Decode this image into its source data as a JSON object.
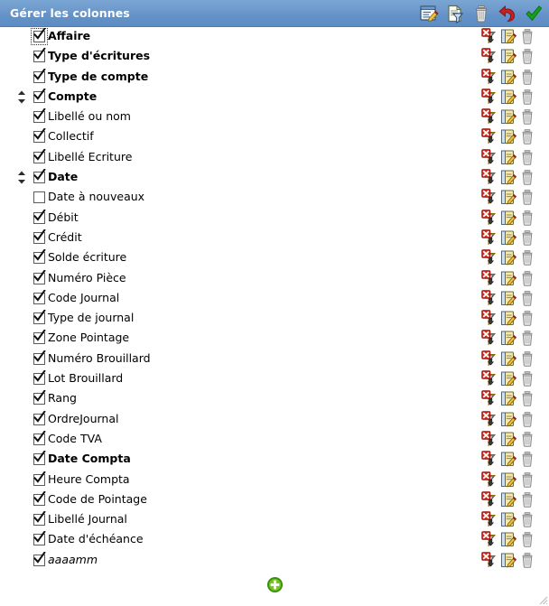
{
  "window": {
    "title": "Gérer les colonnes",
    "titlebar_color": "#6898cc",
    "title_text_color": "#ffffff"
  },
  "toolbar": {
    "icons": [
      {
        "name": "edit-note-icon",
        "label": "Éditer"
      },
      {
        "name": "document-filter-icon",
        "label": "Filtrer"
      },
      {
        "name": "trash-icon",
        "label": "Supprimer"
      },
      {
        "name": "undo-icon",
        "label": "Annuler"
      },
      {
        "name": "validate-check-icon",
        "label": "Valider"
      }
    ]
  },
  "row_action_icons": [
    {
      "name": "remove-filter-icon",
      "label": "Supprimer le filtre"
    },
    {
      "name": "edit-column-icon",
      "label": "Modifier la colonne"
    },
    {
      "name": "delete-column-icon",
      "label": "Supprimer la colonne"
    }
  ],
  "footer": {
    "add_button": {
      "name": "add-column-button",
      "label": "+"
    },
    "resize_grip": {
      "name": "resize-grip",
      "label": ""
    }
  },
  "columns": [
    {
      "label": "Affaire",
      "checked": true,
      "bold": true,
      "italic": false,
      "sortable": false,
      "focused": true
    },
    {
      "label": "Type d'écritures",
      "checked": true,
      "bold": true,
      "italic": false,
      "sortable": false,
      "focused": false
    },
    {
      "label": "Type de compte",
      "checked": true,
      "bold": true,
      "italic": false,
      "sortable": false,
      "focused": false
    },
    {
      "label": "Compte",
      "checked": true,
      "bold": true,
      "italic": false,
      "sortable": true,
      "focused": false
    },
    {
      "label": "Libellé ou nom",
      "checked": true,
      "bold": false,
      "italic": false,
      "sortable": false,
      "focused": false
    },
    {
      "label": "Collectif",
      "checked": true,
      "bold": false,
      "italic": false,
      "sortable": false,
      "focused": false
    },
    {
      "label": "Libellé Ecriture",
      "checked": true,
      "bold": false,
      "italic": false,
      "sortable": false,
      "focused": false
    },
    {
      "label": "Date",
      "checked": true,
      "bold": true,
      "italic": false,
      "sortable": true,
      "focused": false
    },
    {
      "label": "Date à nouveaux",
      "checked": false,
      "bold": false,
      "italic": false,
      "sortable": false,
      "focused": false
    },
    {
      "label": "Débit",
      "checked": true,
      "bold": false,
      "italic": false,
      "sortable": false,
      "focused": false
    },
    {
      "label": "Crédit",
      "checked": true,
      "bold": false,
      "italic": false,
      "sortable": false,
      "focused": false
    },
    {
      "label": "Solde écriture",
      "checked": true,
      "bold": false,
      "italic": false,
      "sortable": false,
      "focused": false
    },
    {
      "label": "Numéro Pièce",
      "checked": true,
      "bold": false,
      "italic": false,
      "sortable": false,
      "focused": false
    },
    {
      "label": "Code Journal",
      "checked": true,
      "bold": false,
      "italic": false,
      "sortable": false,
      "focused": false
    },
    {
      "label": "Type de journal",
      "checked": true,
      "bold": false,
      "italic": false,
      "sortable": false,
      "focused": false
    },
    {
      "label": "Zone Pointage",
      "checked": true,
      "bold": false,
      "italic": false,
      "sortable": false,
      "focused": false
    },
    {
      "label": "Numéro Brouillard",
      "checked": true,
      "bold": false,
      "italic": false,
      "sortable": false,
      "focused": false
    },
    {
      "label": "Lot Brouillard",
      "checked": true,
      "bold": false,
      "italic": false,
      "sortable": false,
      "focused": false
    },
    {
      "label": "Rang",
      "checked": true,
      "bold": false,
      "italic": false,
      "sortable": false,
      "focused": false
    },
    {
      "label": "OrdreJournal",
      "checked": true,
      "bold": false,
      "italic": false,
      "sortable": false,
      "focused": false
    },
    {
      "label": "Code TVA",
      "checked": true,
      "bold": false,
      "italic": false,
      "sortable": false,
      "focused": false
    },
    {
      "label": "Date Compta",
      "checked": true,
      "bold": true,
      "italic": false,
      "sortable": false,
      "focused": false
    },
    {
      "label": "Heure Compta",
      "checked": true,
      "bold": false,
      "italic": false,
      "sortable": false,
      "focused": false
    },
    {
      "label": "Code de Pointage",
      "checked": true,
      "bold": false,
      "italic": false,
      "sortable": false,
      "focused": false
    },
    {
      "label": "Libellé Journal",
      "checked": true,
      "bold": false,
      "italic": false,
      "sortable": false,
      "focused": false
    },
    {
      "label": "Date d'échéance",
      "checked": true,
      "bold": false,
      "italic": false,
      "sortable": false,
      "focused": false
    },
    {
      "label": "aaaamm",
      "checked": true,
      "bold": false,
      "italic": true,
      "sortable": false,
      "focused": false
    }
  ]
}
